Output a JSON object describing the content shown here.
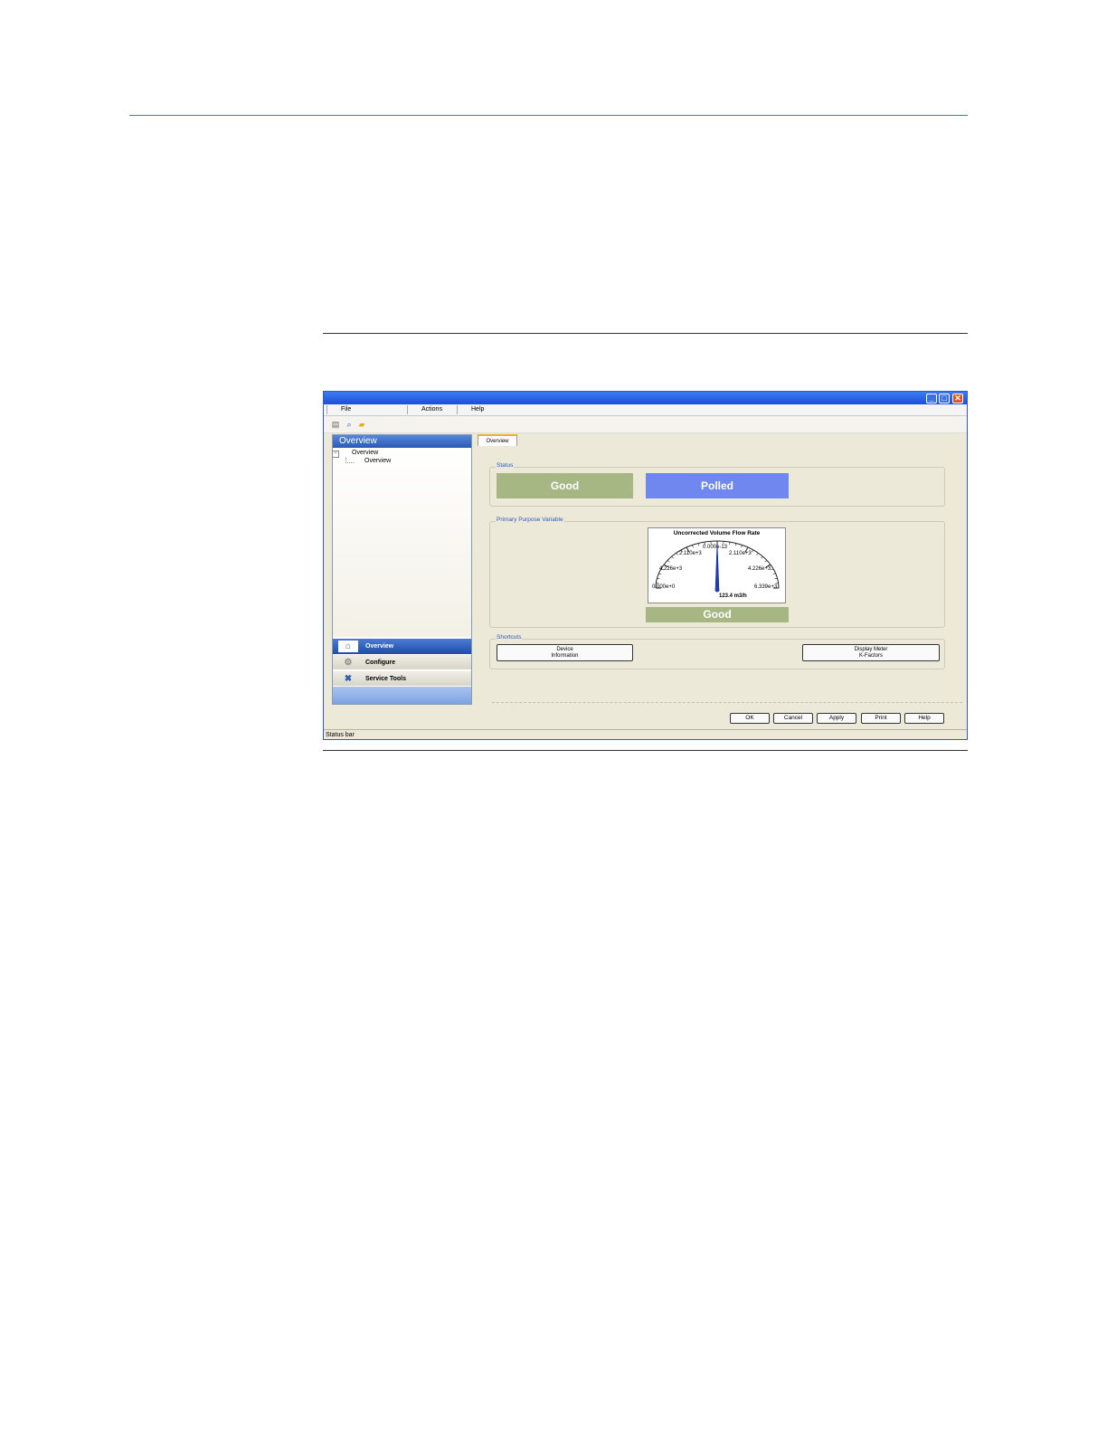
{
  "window": {
    "menu": [
      "File",
      "Actions",
      "Help"
    ],
    "toolbar_icons": [
      "printer-icon",
      "search-icon",
      "folder-icon"
    ]
  },
  "nav": {
    "header": "Overview",
    "tree": {
      "root": "Overview",
      "child": "Overview"
    },
    "buttons": [
      {
        "label": "Overview",
        "icon": "home-icon",
        "active": true
      },
      {
        "label": "Configure",
        "icon": "gear-icon",
        "active": false
      },
      {
        "label": "Service Tools",
        "icon": "tools-icon",
        "active": false
      }
    ]
  },
  "tab": {
    "label": "Overview"
  },
  "status_group": {
    "label": "Status",
    "good": "Good",
    "polled": "Polled",
    "good_color": "#a6b784",
    "polled_color": "#6f87ef"
  },
  "ppv_group": {
    "label": "Primary Purpose Variable",
    "gauge": {
      "title": "Uncorrected Volume Flow Rate",
      "ticks": [
        "0.000e+0",
        "4.226e+3",
        "2.110e+3",
        "0.000e-13",
        "2.110e+3",
        "4.226e+3",
        "6.339e+3"
      ],
      "value_text": "123.4 m3/h",
      "status": "Good",
      "needle_fraction": 0.5
    }
  },
  "shortcuts_group": {
    "label": "Shortcuts",
    "device_info": [
      "Device",
      "Information"
    ],
    "display_meter": [
      "Display Meter",
      "K-Factors"
    ]
  },
  "dialog_buttons": [
    "OK",
    "Cancel",
    "Apply",
    "Print",
    "Help"
  ],
  "statusbar": "Status bar"
}
